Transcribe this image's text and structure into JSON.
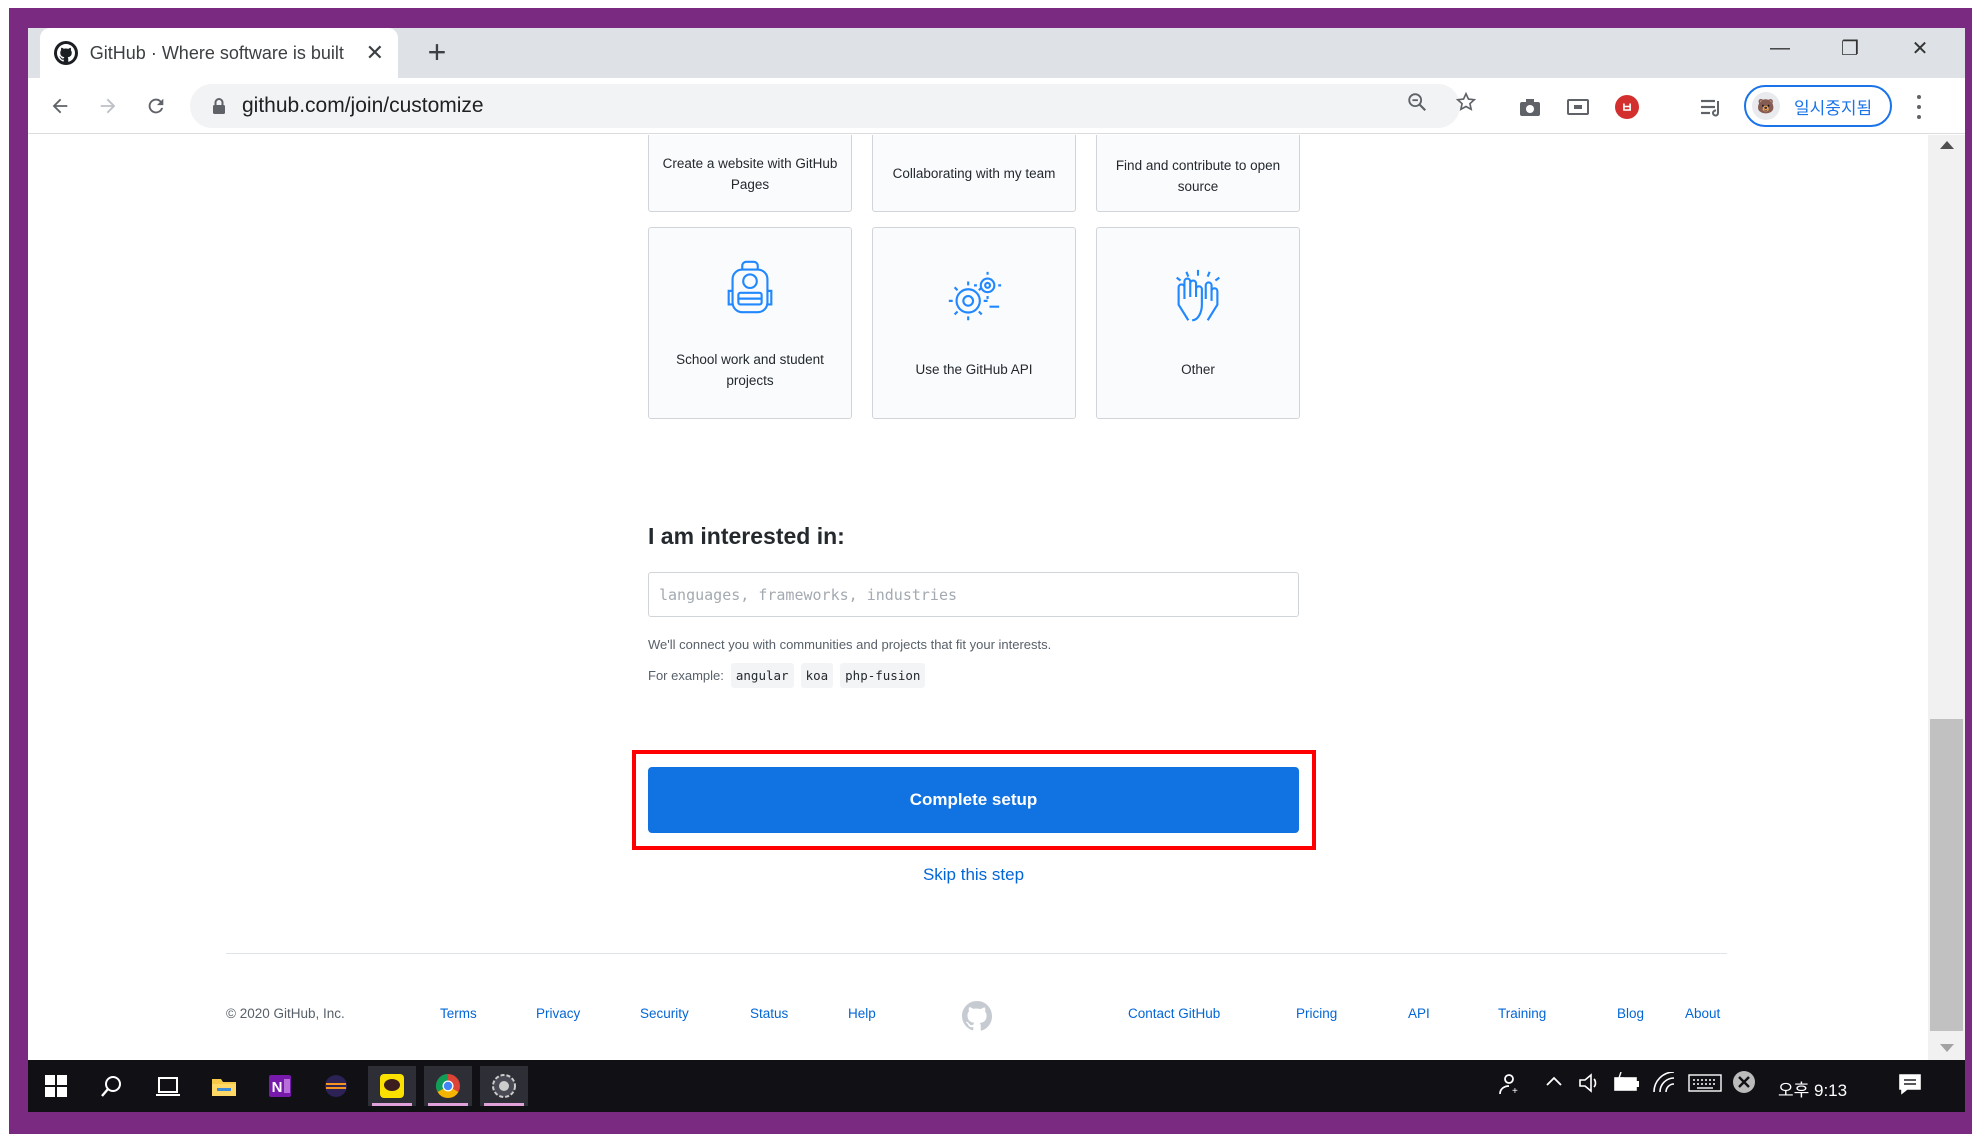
{
  "browser": {
    "tab_title": "GitHub · Where software is built",
    "tab_close": "✕",
    "new_tab": "+",
    "url": "github.com/join/customize",
    "profile_label": "일시중지됨",
    "window_controls": {
      "minimize": "—",
      "restore": "❐",
      "close": "✕"
    }
  },
  "cards_top": [
    {
      "label": "Create a website with GitHub Pages"
    },
    {
      "label": "Collaborating with my team"
    },
    {
      "label": "Find and contribute to open source"
    }
  ],
  "cards_bottom": [
    {
      "label": "School work and student projects",
      "icon": "backpack-icon"
    },
    {
      "label": "Use the GitHub API",
      "icon": "gears-icon"
    },
    {
      "label": "Other",
      "icon": "high-five-icon"
    }
  ],
  "interests": {
    "heading": "I am interested in:",
    "placeholder": "languages, frameworks, industries",
    "value": "",
    "note": "We'll connect you with communities and projects that fit your interests.",
    "example_label": "For example:",
    "examples": [
      "angular",
      "koa",
      "php-fusion"
    ]
  },
  "actions": {
    "complete": "Complete setup",
    "skip": "Skip this step"
  },
  "footer": {
    "copyright": "© 2020 GitHub, Inc.",
    "left_links": [
      "Terms",
      "Privacy",
      "Security",
      "Status",
      "Help"
    ],
    "right_links": [
      "Contact GitHub",
      "Pricing",
      "API",
      "Training",
      "Blog",
      "About"
    ]
  },
  "taskbar": {
    "clock": "오후 9:13"
  },
  "colors": {
    "frame": "#7b2a82",
    "primary_button": "#1172e2",
    "highlight": "#ff0000",
    "link": "#0366d6",
    "icon_blue": "#2188ff"
  }
}
